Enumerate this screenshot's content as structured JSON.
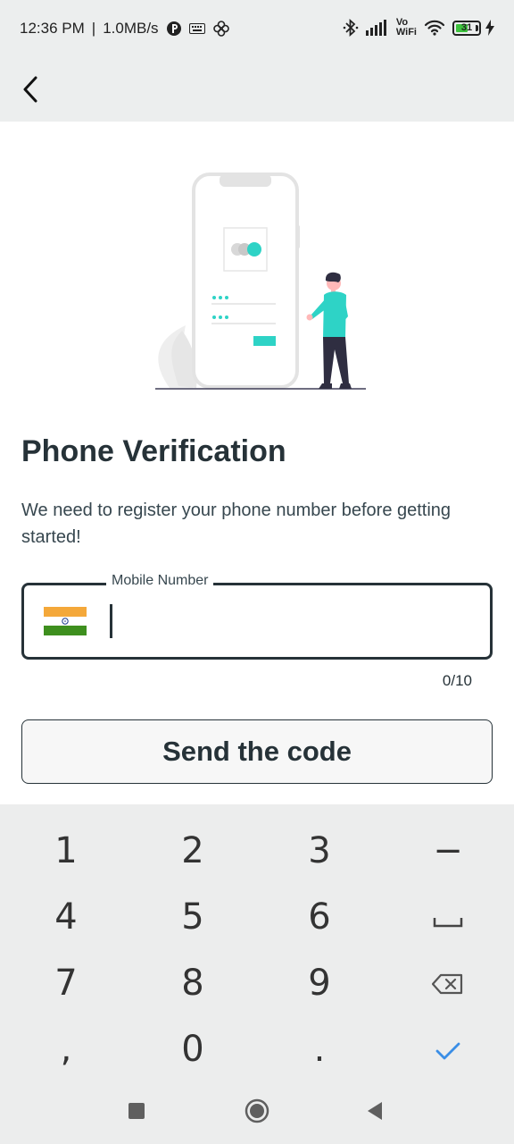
{
  "status_bar": {
    "time": "12:36 PM",
    "separator": "|",
    "speed": "1.0MB/s",
    "vowifi_top": "Vo",
    "vowifi_bottom": "WiFi",
    "battery": "31",
    "icons": [
      "p-circle-icon",
      "keyboard-icon",
      "pinwheel-icon",
      "bluetooth-icon",
      "signal-icon",
      "vowifi-icon",
      "wifi-icon",
      "battery-icon",
      "charging-icon"
    ]
  },
  "app_bar": {
    "back_icon": "chevron-left-icon"
  },
  "content": {
    "title": "Phone Verification",
    "description": "We need to register your phone number before getting started!"
  },
  "mobile_field": {
    "label": "Mobile Number",
    "value": "",
    "counter": "0/10",
    "flag_icon": "india-flag-icon"
  },
  "send_button": {
    "label": "Send the code"
  },
  "keyboard": {
    "keys": [
      [
        "1",
        "2",
        "3",
        "−"
      ],
      [
        "4",
        "5",
        "6",
        "space"
      ],
      [
        "7",
        "8",
        "9",
        "backspace"
      ],
      [
        ",",
        "0",
        ".",
        "done"
      ]
    ]
  },
  "nav_bar": {
    "buttons": [
      "recents-icon",
      "home-icon",
      "back-icon"
    ]
  },
  "colors": {
    "accent": "#2ed3c6",
    "text_dark": "#263238",
    "status_bg": "#eceeee",
    "keyboard_bg": "#eceded",
    "check_blue": "#3a8ee6",
    "flag_saffron": "#f4a83a",
    "flag_green": "#3e8f1e"
  }
}
